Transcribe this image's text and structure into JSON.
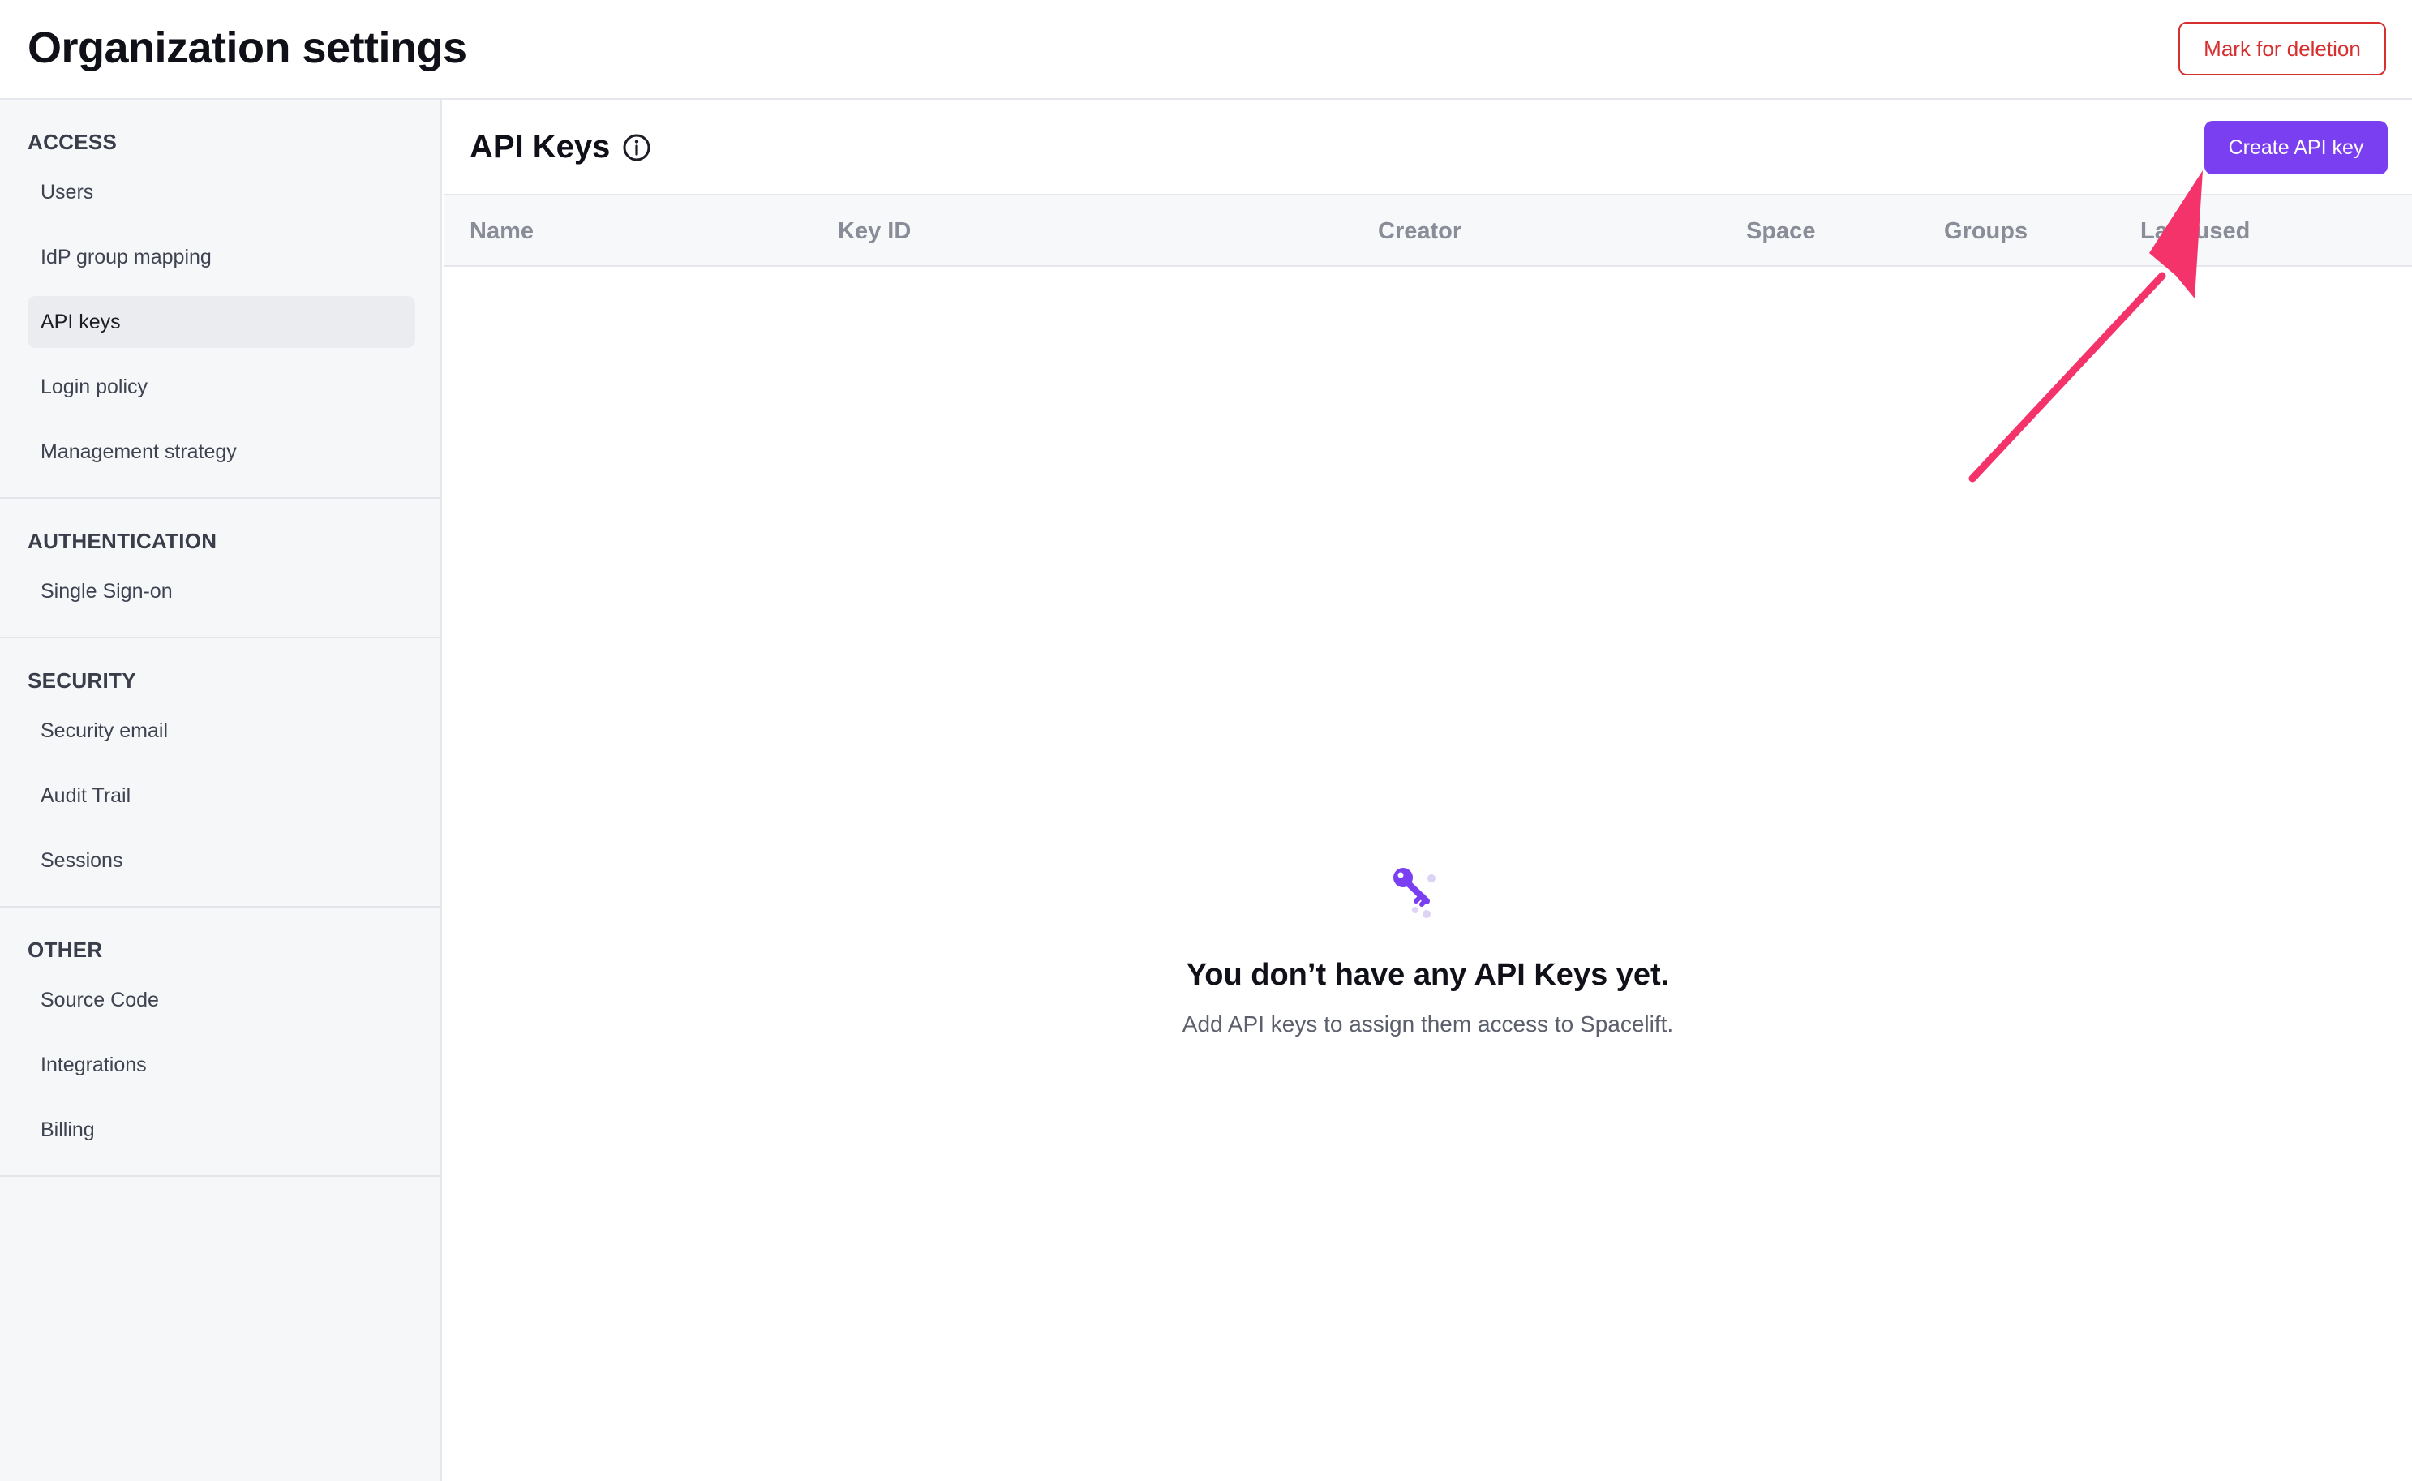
{
  "header": {
    "title": "Organization settings",
    "delete_label": "Mark for deletion"
  },
  "sidebar": {
    "sections": [
      {
        "heading": "ACCESS",
        "items": [
          "Users",
          "IdP group mapping",
          "API keys",
          "Login policy",
          "Management strategy"
        ]
      },
      {
        "heading": "AUTHENTICATION",
        "items": [
          "Single Sign-on"
        ]
      },
      {
        "heading": "SECURITY",
        "items": [
          "Security email",
          "Audit Trail",
          "Sessions"
        ]
      },
      {
        "heading": "OTHER",
        "items": [
          "Source Code",
          "Integrations",
          "Billing"
        ]
      }
    ],
    "active_item": "API keys"
  },
  "main": {
    "title": "API Keys",
    "create_label": "Create API key",
    "columns": [
      "Name",
      "Key ID",
      "Creator",
      "Space",
      "Groups",
      "Last used"
    ],
    "empty_title": "You don’t have any API Keys yet.",
    "empty_subtitle": "Add API keys to assign them access to Spacelift."
  },
  "icons": {
    "info": "info-icon",
    "empty_state": "key-icon",
    "annotation": "arrow-annotation"
  },
  "colors": {
    "accent": "#7b3ff2",
    "danger": "#d62f2f",
    "annotation": "#f5336b"
  }
}
